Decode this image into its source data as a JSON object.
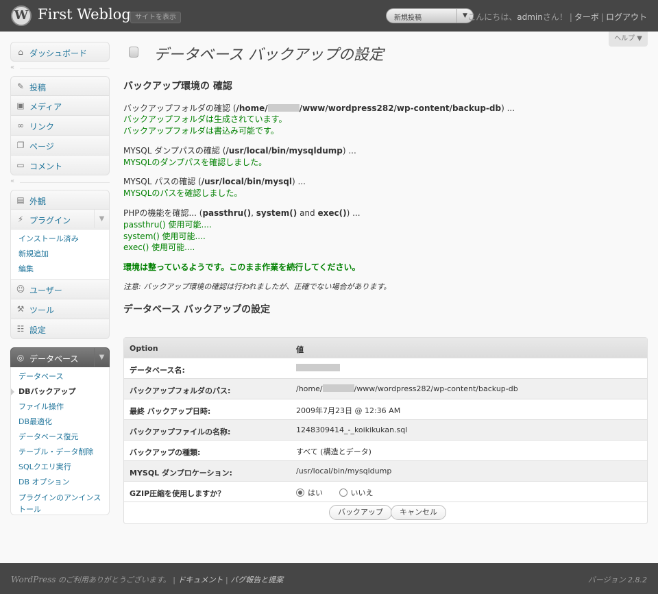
{
  "header": {
    "site_title": "First Weblog",
    "view_site": "サイトを表示",
    "favorite_action": "新規投稿",
    "greeting": "こんにちは、",
    "username": "admin",
    "greeting_suffix": "さん！",
    "turbo": "ターボ",
    "logout": "ログアウト"
  },
  "help_tab": "ヘルプ ▼",
  "sidebar": {
    "dashboard": "ダッシュボード",
    "posts": "投稿",
    "media": "メディア",
    "links": "リンク",
    "pages": "ページ",
    "comments": "コメント",
    "appearance": "外観",
    "plugins": "プラグイン",
    "plugins_sub": [
      "インストール済み",
      "新規追加",
      "編集"
    ],
    "users": "ユーザー",
    "tools": "ツール",
    "settings": "設定",
    "database": "データベース",
    "database_sub": [
      "データベース",
      "DBバックアップ",
      "ファイル操作",
      "DB最適化",
      "データベース復元",
      "テーブル・データ削除",
      "SQLクエリ実行",
      "DB オプション",
      "プラグインのアンインストール"
    ]
  },
  "main": {
    "page_title": "データベース バックアップの設定",
    "env_heading": "バックアップ環境の 確認",
    "backup_folder_check_prefix": "バックアップフォルダの確認 (",
    "backup_folder_path_a": "/home/",
    "backup_folder_path_b": "/www/wordpress282/wp-content/backup-db",
    "check_suffix": ") ...",
    "backup_folder_ok1": "バックアップフォルダは生成されています。",
    "backup_folder_ok2": "バックアップフォルダは書込み可能です。",
    "mysqldump_check_prefix": "MYSQL ダンプパスの確認 (",
    "mysqldump_path": "/usr/local/bin/mysqldump",
    "mysqldump_ok": "MYSQLのダンプパスを確認しました。",
    "mysql_check_prefix": "MYSQL パスの確認 (",
    "mysql_path": "/usr/local/bin/mysql",
    "mysql_ok": "MYSQLのパスを確認しました。",
    "php_check_prefix": "PHPの機能を確認... (",
    "php_func1": "passthru()",
    "php_sep": ",",
    "php_func2": "system()",
    "php_and": "and",
    "php_func3": "exec()",
    "php_suffix": ") ...",
    "passthru_ok": "passthru() 使用可能....",
    "system_ok": "system() 使用可能....",
    "exec_ok": "exec() 使用可能....",
    "env_ready": "環境は整っているようです。このまま作業を続行してください。",
    "note_label": "注意:",
    "note_text": "バックアップ環境の確認は行われましたが、正確でない場合があります。",
    "settings_heading": "データベース バックアップの設定"
  },
  "table": {
    "header_option": "Option",
    "header_value": "値",
    "rows": [
      {
        "label": "データベース名:",
        "value": ""
      },
      {
        "label": "バックアップフォルダのパス:",
        "value_a": "/home/",
        "value_b": "/www/wordpress282/wp-content/backup-db"
      },
      {
        "label": "最終 バックアップ日時:",
        "value": "2009年7月23日 @ 12:36 AM"
      },
      {
        "label": "バックアップファイルの名称:",
        "value": "1248309414_-_koikikukan.sql"
      },
      {
        "label": "バックアップの種類:",
        "value": "すべて (構造とデータ)"
      },
      {
        "label": "MYSQL ダンプロケーション:",
        "value": "/usr/local/bin/mysqldump"
      },
      {
        "label": "GZIP圧縮を使用しますか？",
        "option_yes": "はい",
        "option_no": "いいえ",
        "selected": "はい"
      }
    ],
    "backup_button": "バックアップ",
    "cancel_button": "キャンセル"
  },
  "footer": {
    "wordpress": "WordPress",
    "thanks": "のご利用ありがとうございます。",
    "docs": "ドキュメント",
    "feedback": "バグ報告と提案",
    "version": "バージョン 2.8.2"
  }
}
